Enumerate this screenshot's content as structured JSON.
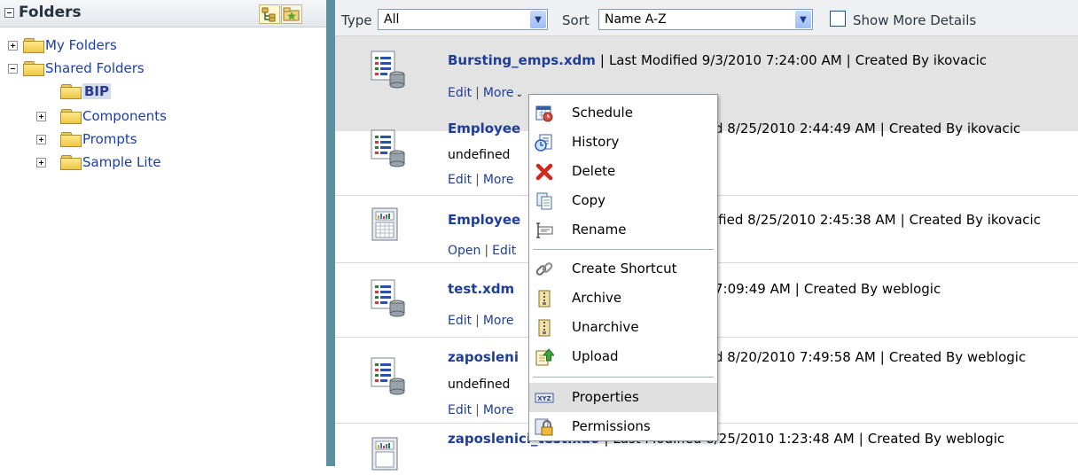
{
  "folders_pane": {
    "title": "Folders",
    "tree": [
      {
        "label": "My Folders",
        "expander": "plus",
        "level": 0
      },
      {
        "label": "Shared Folders",
        "expander": "minus",
        "level": 0
      },
      {
        "label": "BIP",
        "expander": "none",
        "level": 1,
        "selected": true
      },
      {
        "label": "Components",
        "expander": "plus",
        "level": 1
      },
      {
        "label": "Prompts",
        "expander": "plus",
        "level": 1
      },
      {
        "label": "Sample Lite",
        "expander": "plus",
        "level": 1
      }
    ]
  },
  "toolbar": {
    "type_label": "Type",
    "type_value": "All",
    "sort_label": "Sort",
    "sort_value": "Name A-Z",
    "show_more_label": "Show More Details",
    "show_more_checked": false
  },
  "items": [
    {
      "name": "Bursting_emps.xdm",
      "meta": "Last Modified 9/3/2010 7:24:00 AM",
      "created": "Created By ikovacic",
      "links": [
        "Edit",
        "More"
      ],
      "icon": "data-model-icon"
    },
    {
      "name": "Employee",
      "meta": "d 8/25/2010 2:44:49 AM",
      "created": "Created By ikovacic",
      "description": "undefined",
      "links": [
        "Edit",
        "More"
      ],
      "icon": "data-model-icon"
    },
    {
      "name": "Employee",
      "meta": "ified 8/25/2010 2:45:38 AM",
      "created": "Created By ikovacic",
      "links": [
        "Open",
        "Edit"
      ],
      "icon": "report-icon"
    },
    {
      "name": "test.xdm",
      "meta": "7:09:49 AM",
      "created": "Created By weblogic",
      "links": [
        "Edit",
        "More"
      ],
      "icon": "data-model-icon"
    },
    {
      "name": "zaposleni",
      "meta": "d 8/20/2010 7:49:58 AM",
      "created": "Created By weblogic",
      "description": "undefined",
      "links": [
        "Edit",
        "More"
      ],
      "icon": "data-model-icon"
    },
    {
      "name": "zaposlenici_test.xdo",
      "meta": "Last Modified 8/25/2010 1:23:48 AM",
      "created": "Created By weblogic",
      "icon": "report-icon"
    }
  ],
  "context_menu": {
    "items": [
      {
        "label": "Schedule",
        "icon": "schedule-icon"
      },
      {
        "label": "History",
        "icon": "history-icon"
      },
      {
        "label": "Delete",
        "icon": "delete-icon"
      },
      {
        "label": "Copy",
        "icon": "copy-icon"
      },
      {
        "label": "Rename",
        "icon": "rename-icon"
      },
      {
        "label": "Create Shortcut",
        "icon": "shortcut-icon"
      },
      {
        "label": "Archive",
        "icon": "archive-icon"
      },
      {
        "label": "Unarchive",
        "icon": "unarchive-icon"
      },
      {
        "label": "Upload",
        "icon": "upload-icon"
      },
      {
        "label": "Properties",
        "icon": "properties-icon",
        "active": true
      },
      {
        "label": "Permissions",
        "icon": "permissions-icon"
      }
    ]
  },
  "colors": {
    "link": "#1f3e99",
    "divider": "#5c8fa0",
    "highlight_row": "#e3e3e3"
  }
}
